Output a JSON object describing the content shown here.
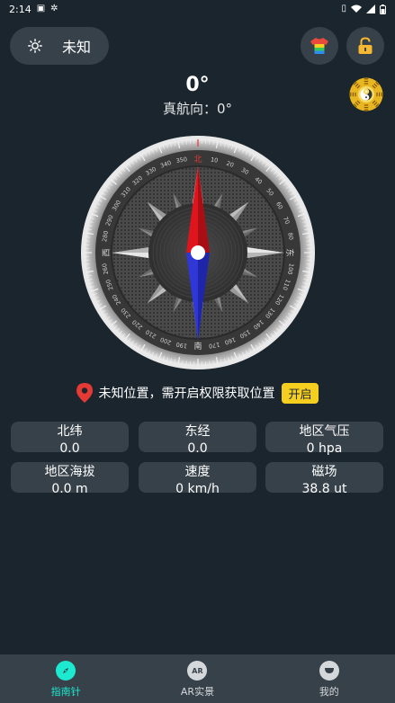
{
  "status_bar": {
    "time": "2:14",
    "left_icons": [
      "notification-icon",
      "bug-icon"
    ],
    "right_icons": [
      "vibrate-icon",
      "wifi-icon",
      "signal-icon",
      "battery-icon"
    ]
  },
  "header": {
    "weather_label": "未知",
    "heading_value": "0°",
    "true_heading": "真航向：0°"
  },
  "compass": {
    "degree_labels": [
      "0",
      "10",
      "20",
      "30",
      "40",
      "50",
      "60",
      "70",
      "80",
      "90",
      "100",
      "110",
      "120",
      "130",
      "140",
      "150",
      "160",
      "170",
      "180",
      "190",
      "200",
      "210",
      "220",
      "230",
      "240",
      "250",
      "260",
      "270",
      "280",
      "290",
      "300",
      "310",
      "320",
      "330",
      "340",
      "350"
    ],
    "north": "北",
    "south": "南",
    "east": "东",
    "west": "西"
  },
  "location": {
    "text": "未知位置，需开启权限获取位置",
    "button": "开启"
  },
  "info_cards": [
    {
      "title": "北纬",
      "value": "0.0"
    },
    {
      "title": "东经",
      "value": "0.0"
    },
    {
      "title": "地区气压",
      "value": "0 hpa"
    },
    {
      "title": "地区海拔",
      "value": "0.0 m"
    },
    {
      "title": "速度",
      "value": "0 km/h"
    },
    {
      "title": "磁场",
      "value": "38.8 ut"
    }
  ],
  "bottom_nav": [
    {
      "label": "指南针",
      "icon": "compass-icon"
    },
    {
      "label": "AR实景",
      "icon": "ar-icon",
      "icon_text": "AR"
    },
    {
      "label": "我的",
      "icon": "profile-icon"
    }
  ],
  "colors": {
    "background": "#1b252d",
    "card": "#37414a",
    "accent": "#1de9d0",
    "button_yellow": "#f5cf1f",
    "needle_north": "#e0141c",
    "needle_south": "#2f37d6"
  }
}
